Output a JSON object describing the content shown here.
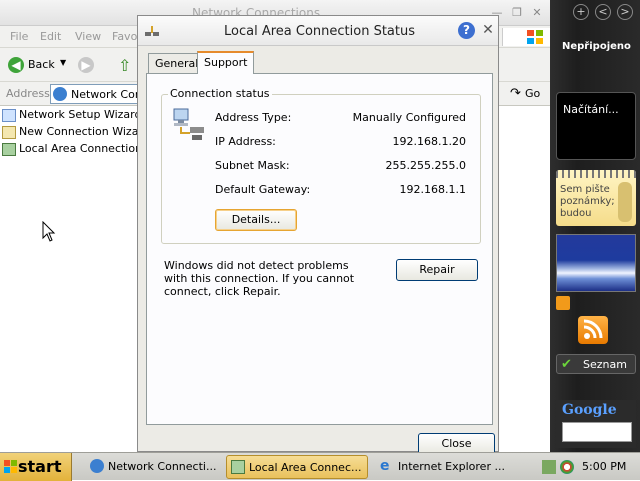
{
  "explorer": {
    "title": "Network Connections",
    "menu": [
      "File",
      "Edit",
      "View",
      "Favo"
    ],
    "toolbar": {
      "back_label": "Back"
    },
    "address": {
      "label": "Address",
      "value": "Network Conn",
      "go_label": "Go"
    },
    "tree": [
      "Network Setup Wizard",
      "New Connection Wizard",
      "Local Area Connection"
    ]
  },
  "dialog": {
    "title": "Local Area Connection Status",
    "tabs": [
      "General",
      "Support"
    ],
    "active_tab": "Support",
    "group_title": "Connection status",
    "rows": [
      {
        "label": "Address Type:",
        "value": "Manually Configured"
      },
      {
        "label": "IP Address:",
        "value": "192.168.1.20"
      },
      {
        "label": "Subnet Mask:",
        "value": "255.255.255.0"
      },
      {
        "label": "Default Gateway:",
        "value": "192.168.1.1"
      }
    ],
    "details_label": "Details...",
    "repair_text": "Windows did not detect problems with this connection. If you cannot connect, click Repair.",
    "repair_label": "Repair",
    "close_label": "Close"
  },
  "sidebar": {
    "controls": [
      "+",
      "<",
      ">"
    ],
    "network_status": "Nepřipojeno",
    "loading_text": "Načítání...",
    "notes_text": "Sem pište poznámky; budou",
    "seznam_label": "Seznam",
    "google_label": "Google"
  },
  "taskbar": {
    "start_label": "start",
    "tasks": [
      {
        "label": "Network Connecti...",
        "icon": "network-folder-icon"
      },
      {
        "label": "Local Area Connec...",
        "icon": "network-connection-icon"
      },
      {
        "label": "Internet Explorer ...",
        "icon": "internet-explorer-icon"
      }
    ],
    "clock": "5:00 PM"
  },
  "colors": {
    "accent_tab": "#e68b2c",
    "start": "#e3b23a",
    "sidebar": "#242424"
  }
}
